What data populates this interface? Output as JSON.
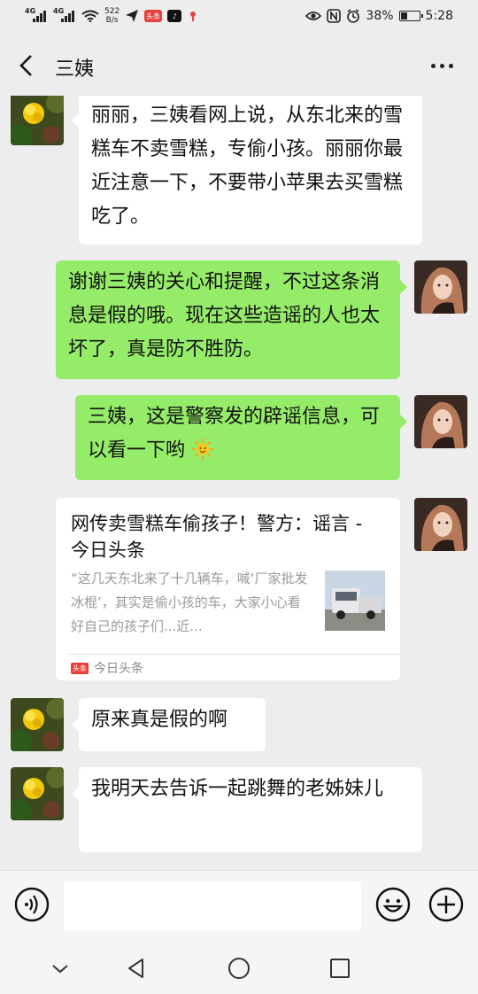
{
  "status_bar": {
    "network_1": "4G",
    "network_2": "4G",
    "speed_value": "522",
    "speed_unit": "B/s",
    "toutiao_icon_text": "头条",
    "battery": "38%",
    "time": "5:28"
  },
  "header": {
    "title": "三姨"
  },
  "messages": [
    {
      "side": "in",
      "text": "丽丽，三姨看网上说，从东北来的雪糕车不卖雪糕，专偷小孩。丽丽你最近注意一下，不要带小苹果去买雪糕吃了。"
    },
    {
      "side": "out",
      "text": "谢谢三姨的关心和提醒，不过这条消息是假的哦。现在这些造谣的人也太坏了，真是防不胜防。"
    },
    {
      "side": "out",
      "text": "三姨，这是警察发的辟谣信息，可以看一下哟"
    },
    {
      "side": "in",
      "text": "原来真是假的啊"
    },
    {
      "side": "in",
      "text": "我明天去告诉一起跳舞的老姊妹儿"
    }
  ],
  "link_card": {
    "title": "网传卖雪糕车偷孩子！警方：谣言 - 今日头条",
    "description": "“这几天东北来了十几辆车，喊‘厂家批发冰棍’，其实是偷小孩的车，大家小心看好自己的孩子们...近...",
    "source_badge": "头条",
    "source": "今日头条"
  },
  "input": {
    "value": ""
  },
  "colors": {
    "background": "#ededed",
    "bubble_out": "#95ec69",
    "bubble_in": "#ffffff",
    "toutiao_red": "#e8403a"
  },
  "icons": [
    "back-arrow-icon",
    "more-dots-icon",
    "voice-icon",
    "emoji-icon",
    "plus-icon",
    "nav-back-icon",
    "nav-home-icon",
    "nav-recent-icon",
    "nav-collapse-icon",
    "sun-emoji-icon"
  ]
}
